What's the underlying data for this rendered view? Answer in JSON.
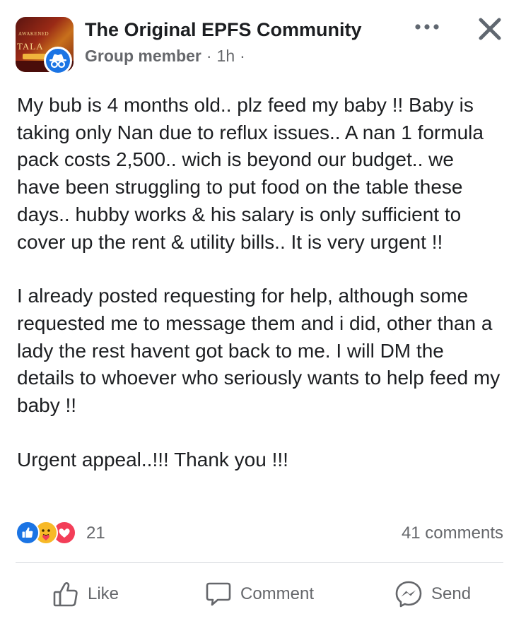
{
  "post": {
    "group_name": "The Original EPFS Community",
    "author_role": "Group member",
    "time": "1h",
    "separator": "·",
    "trail": "·",
    "paragraphs": [
      "My bub is 4 months old.. plz feed my baby !! Baby is taking only Nan due to reflux issues.. A nan 1 formula pack costs 2,500.. wich is beyond our budget.. we have been struggling to put food on the table these days.. hubby works & his salary is only sufficient to cover up the rent & utility bills.. It is very urgent !!",
      "I already posted requesting for help, although some requested me to message them and i did, other than a lady the rest havent got back to me. I will DM the details to whoever who seriously wants to help feed my baby !!",
      "Urgent appeal..!!! Thank you !!!"
    ],
    "avatar_text": {
      "top": "AWAKENED",
      "mid": "TALA",
      "bottom": ""
    }
  },
  "engagement": {
    "reaction_icons": [
      "like-icon",
      "care-icon",
      "love-icon"
    ],
    "reaction_count": "21",
    "comments_label": "41 comments"
  },
  "actions": {
    "like_label": "Like",
    "comment_label": "Comment",
    "send_label": "Send"
  },
  "colors": {
    "brand_blue": "#1b74e4",
    "love_red": "#f33e58",
    "care_yellow": "#f7b928",
    "secondary_text": "#65676b",
    "primary_text": "#1c1e21"
  }
}
